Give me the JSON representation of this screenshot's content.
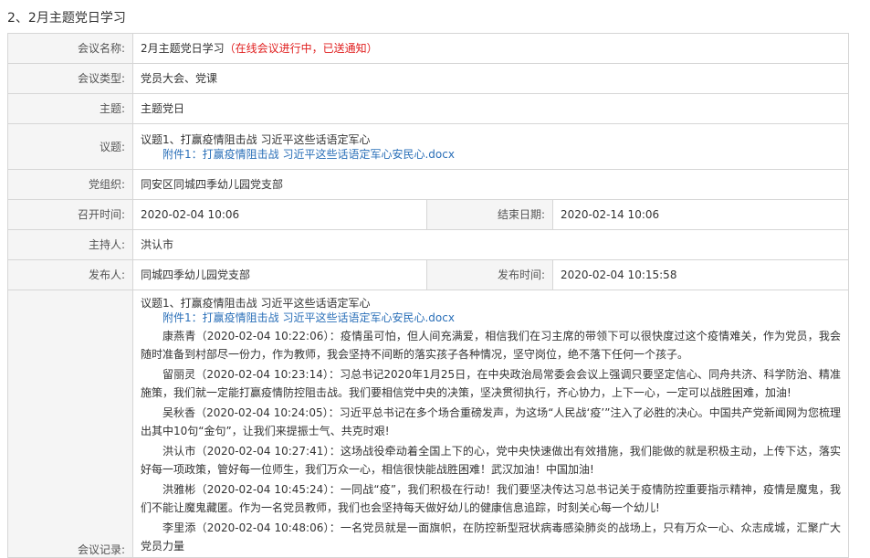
{
  "section_title": "2、2月主题党日学习",
  "meeting": {
    "name_label": "会议名称:",
    "name_value": "2月主题党日学习",
    "name_status": "（在线会议进行中，已送通知）",
    "type_label": "会议类型:",
    "type_value": "党员大会、党课",
    "theme_label": "主题:",
    "theme_value": "主题党日",
    "agenda_label": "议题:",
    "agenda_value": "议题1、打赢疫情阻击战 习近平这些话语定军心",
    "agenda_attachment": "附件1：打赢疫情阻击战 习近平这些话语定军心安民心.docx",
    "org_label": "党组织:",
    "org_value": "同安区同城四季幼儿园党支部",
    "start_label": "召开时间:",
    "start_value": "2020-02-04 10:06",
    "end_label": "结束日期:",
    "end_value": "2020-02-14 10:06",
    "host_label": "主持人:",
    "host_value": "洪认市",
    "publisher_label": "发布人:",
    "publisher_value": "同城四季幼儿园党支部",
    "publish_time_label": "发布时间:",
    "publish_time_value": "2020-02-04 10:15:58",
    "record_label": "会议记录:",
    "record_topic": "议题1、打赢疫情阻击战 习近平这些话语定军心",
    "record_attachment": "附件1：打赢疫情阻击战 习近平这些话语定军心安民心.docx"
  },
  "records": [
    "康燕青（2020-02-04 10:22:06）：疫情虽可怕，但人间充满爱，相信我们在习主席的带领下可以很快度过这个疫情难关，作为党员，我会随时准备到村部尽一份力，作为教师，我会坚持不间断的落实孩子各种情况，坚守岗位，绝不落下任何一个孩子。",
    "留丽灵（2020-02-04 10:23:14）：习总书记2020年1月25日，在中央政治局常委会会议上强调只要坚定信心、同舟共济、科学防治、精准施策，我们就一定能打赢疫情防控阻击战。我们要相信党中央的决策，坚决贯彻执行，齐心协力，上下一心，一定可以战胜困难，加油!",
    "吴秋香（2020-02-04 10:24:05）：习近平总书记在多个场合重磅发声，为这场“人民战‘疫’”注入了必胜的决心。中国共产党新闻网为您梳理出其中10句“金句”，让我们来提振士气、共克时艰!",
    "洪认市（2020-02-04 10:27:41）：这场战役牵动着全国上下的心，党中央快速做出有效措施，我们能做的就是积极主动，上传下达，落实好每一项政策，管好每一位师生，我们万众一心，相信很快能战胜困难！武汉加油！中国加油!",
    "洪雅彬（2020-02-04 10:45:24）：一同战“疫”，我们积极在行动！我们要坚决传达习总书记关于疫情防控重要指示精神，疫情是魔鬼，我们不能让魔鬼藏匿。作为一名党员教师，我们也会坚持每天做好幼儿的健康信息追踪，时刻关心每一个幼儿!",
    "李里添（2020-02-04 10:48:06）：一名党员就是一面旗帜，在防控新型冠状病毒感染肺炎的战场上，只有万众一心、众志成城，汇聚广大党员力量"
  ]
}
